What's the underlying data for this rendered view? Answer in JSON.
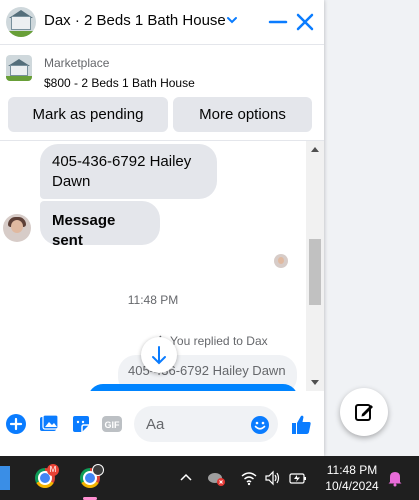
{
  "header": {
    "title": "Dax · 2 Beds 1 Bath House"
  },
  "listing": {
    "label": "Marketplace",
    "price_title": "$800 - 2 Beds 1 Bath House"
  },
  "actions": {
    "mark_pending": "Mark as pending",
    "more_options": "More options"
  },
  "messages": {
    "incoming": [
      "405-436-6792 Hailey Dawn",
      "Message sent"
    ],
    "timestamp": "11:48 PM",
    "reply_note": "You replied to Dax",
    "reply_quote": "405-436-6792 Hailey Dawn"
  },
  "composer": {
    "placeholder": "Aa",
    "gif_label": "GIF"
  },
  "taskbar": {
    "time": "11:48 PM",
    "date": "10/4/2024",
    "chrome_badge": "M"
  },
  "colors": {
    "accent": "#0084ff",
    "messenger_blue": "#0a7cff",
    "bubble_gray": "#e4e6eb"
  }
}
